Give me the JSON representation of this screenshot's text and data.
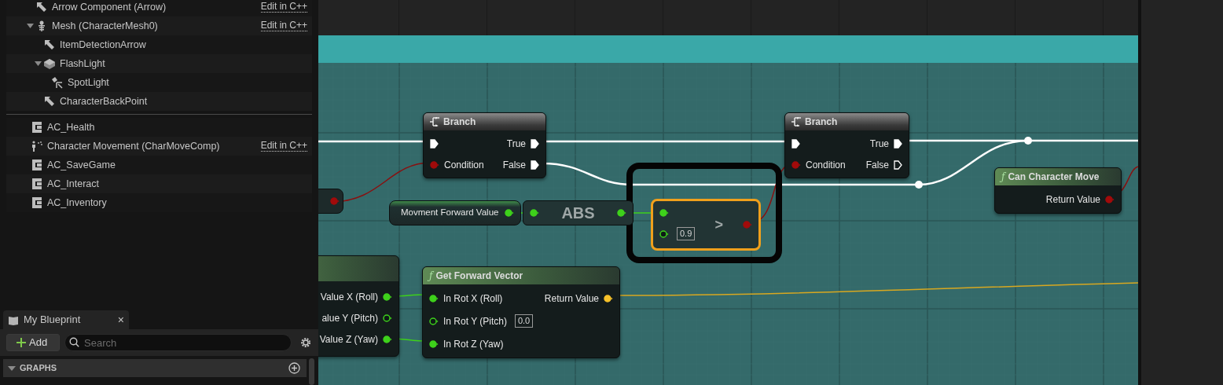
{
  "components": [
    {
      "label": "Arrow Component (Arrow)",
      "kind": "arrow",
      "edit_link": "Edit in C++"
    },
    {
      "label": "Mesh (CharacterMesh0)",
      "kind": "skeleton",
      "edit_link": "Edit in C++",
      "expanded": true,
      "children": [
        {
          "label": "ItemDetectionArrow",
          "kind": "arrow"
        },
        {
          "label": "FlashLight",
          "kind": "cube",
          "expanded": true,
          "children": [
            {
              "label": "SpotLight",
              "kind": "spotlight"
            }
          ]
        },
        {
          "label": "CharacterBackPoint",
          "kind": "arrow"
        }
      ]
    }
  ],
  "actor_components": [
    {
      "label": "AC_Health",
      "kind": "component"
    },
    {
      "label": "Character Movement (CharMoveComp)",
      "kind": "movement",
      "edit_link": "Edit in C++"
    },
    {
      "label": "AC_SaveGame",
      "kind": "component"
    },
    {
      "label": "AC_Interact",
      "kind": "component"
    },
    {
      "label": "AC_Inventory",
      "kind": "component"
    }
  ],
  "my_blueprint": {
    "tab": "My Blueprint",
    "close": "×",
    "add_label": "Add",
    "search": {
      "placeholder": "Search"
    },
    "sections": [
      {
        "label": "GRAPHS",
        "expanded": true
      }
    ]
  },
  "graph": {
    "nodes": [
      {
        "kind": "stub",
        "outputs": [
          {
            "kind": "bool",
            "connected": true
          }
        ]
      },
      {
        "kind": "branch",
        "title": "Branch",
        "inputs": [
          {
            "kind": "exec",
            "connected": true
          },
          {
            "label": "Condition",
            "kind": "bool",
            "connected": true
          }
        ],
        "outputs": [
          {
            "label": "True",
            "kind": "exec",
            "connected": true
          },
          {
            "label": "False",
            "kind": "exec",
            "connected": true
          }
        ]
      },
      {
        "kind": "branch",
        "title": "Branch",
        "inputs": [
          {
            "kind": "exec",
            "connected": true
          },
          {
            "label": "Condition",
            "kind": "bool",
            "connected": true
          }
        ],
        "outputs": [
          {
            "label": "True",
            "kind": "exec",
            "connected": true
          },
          {
            "label": "False",
            "kind": "exec",
            "connected": false
          }
        ]
      },
      {
        "kind": "variable",
        "title": "Movment Forward Value",
        "outputs": [
          {
            "kind": "float",
            "connected": true
          }
        ]
      },
      {
        "kind": "pure",
        "title": "ABS",
        "inputs": [
          {
            "kind": "float",
            "connected": true
          }
        ],
        "outputs": [
          {
            "kind": "float",
            "connected": true
          }
        ]
      },
      {
        "kind": "compare",
        "title": ">",
        "selected": true,
        "inputs": [
          {
            "kind": "float",
            "connected": true
          },
          {
            "kind": "float",
            "connected": false,
            "default": "0.9"
          }
        ],
        "outputs": [
          {
            "kind": "bool",
            "connected": true
          }
        ]
      },
      {
        "kind": "function",
        "glyph": "ƒ",
        "title": "Can Character Move",
        "outputs": [
          {
            "label": "Return Value",
            "kind": "bool",
            "connected": true
          }
        ]
      },
      {
        "kind": "break",
        "outputs": [
          {
            "label": "Value X (Roll)",
            "kind": "float",
            "connected": true
          },
          {
            "label": "alue Y (Pitch)",
            "kind": "float",
            "connected": false
          },
          {
            "label": "Value Z (Yaw)",
            "kind": "float",
            "connected": true
          }
        ]
      },
      {
        "kind": "function",
        "glyph": "ƒ",
        "title": "Get Forward Vector",
        "inputs": [
          {
            "label": "In Rot X (Roll)",
            "kind": "float",
            "connected": true
          },
          {
            "label": "In Rot Y (Pitch)",
            "kind": "float",
            "connected": false,
            "default": "0.0"
          },
          {
            "label": "In Rot Z (Yaw)",
            "kind": "float",
            "connected": true
          }
        ],
        "outputs": [
          {
            "label": "Return Value",
            "kind": "vector",
            "connected": true
          }
        ]
      }
    ]
  }
}
